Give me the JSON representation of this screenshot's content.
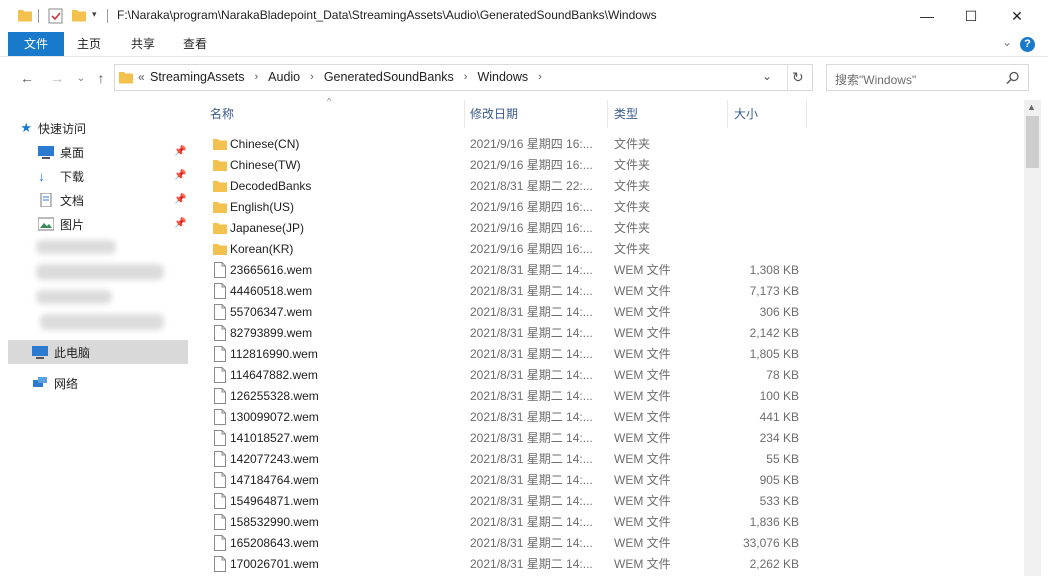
{
  "window": {
    "title": "F:\\Naraka\\program\\NarakaBladepoint_Data\\StreamingAssets\\Audio\\GeneratedSoundBanks\\Windows",
    "minimize_glyph": "—",
    "maximize_glyph": "☐",
    "close_glyph": "✕"
  },
  "ribbon": {
    "tabs": [
      "文件",
      "主页",
      "共享",
      "查看"
    ],
    "expand_glyph": "⌄",
    "help_glyph": "?"
  },
  "address": {
    "overflow": "«",
    "crumbs": [
      "StreamingAssets",
      "Audio",
      "GeneratedSoundBanks",
      "Windows"
    ],
    "dropdown_glyph": "⌄",
    "refresh_glyph": "↻"
  },
  "search": {
    "placeholder": "搜索\"Windows\""
  },
  "nav": {
    "quick_access": "快速访问",
    "pinned": [
      "桌面",
      "下载",
      "文档",
      "图片"
    ],
    "this_pc": "此电脑",
    "network": "网络"
  },
  "columns": {
    "name": "名称",
    "date": "修改日期",
    "type": "类型",
    "size": "大小"
  },
  "files": [
    {
      "name": "Chinese(CN)",
      "date": "2021/9/16 星期四 16:...",
      "type": "文件夹",
      "size": "",
      "kind": "folder"
    },
    {
      "name": "Chinese(TW)",
      "date": "2021/9/16 星期四 16:...",
      "type": "文件夹",
      "size": "",
      "kind": "folder"
    },
    {
      "name": "DecodedBanks",
      "date": "2021/8/31 星期二 22:...",
      "type": "文件夹",
      "size": "",
      "kind": "folder"
    },
    {
      "name": "English(US)",
      "date": "2021/9/16 星期四 16:...",
      "type": "文件夹",
      "size": "",
      "kind": "folder"
    },
    {
      "name": "Japanese(JP)",
      "date": "2021/9/16 星期四 16:...",
      "type": "文件夹",
      "size": "",
      "kind": "folder"
    },
    {
      "name": "Korean(KR)",
      "date": "2021/9/16 星期四 16:...",
      "type": "文件夹",
      "size": "",
      "kind": "folder"
    },
    {
      "name": "23665616.wem",
      "date": "2021/8/31 星期二 14:...",
      "type": "WEM 文件",
      "size": "1,308 KB",
      "kind": "file"
    },
    {
      "name": "44460518.wem",
      "date": "2021/8/31 星期二 14:...",
      "type": "WEM 文件",
      "size": "7,173 KB",
      "kind": "file"
    },
    {
      "name": "55706347.wem",
      "date": "2021/8/31 星期二 14:...",
      "type": "WEM 文件",
      "size": "306 KB",
      "kind": "file"
    },
    {
      "name": "82793899.wem",
      "date": "2021/8/31 星期二 14:...",
      "type": "WEM 文件",
      "size": "2,142 KB",
      "kind": "file"
    },
    {
      "name": "112816990.wem",
      "date": "2021/8/31 星期二 14:...",
      "type": "WEM 文件",
      "size": "1,805 KB",
      "kind": "file"
    },
    {
      "name": "114647882.wem",
      "date": "2021/8/31 星期二 14:...",
      "type": "WEM 文件",
      "size": "78 KB",
      "kind": "file"
    },
    {
      "name": "126255328.wem",
      "date": "2021/8/31 星期二 14:...",
      "type": "WEM 文件",
      "size": "100 KB",
      "kind": "file"
    },
    {
      "name": "130099072.wem",
      "date": "2021/8/31 星期二 14:...",
      "type": "WEM 文件",
      "size": "441 KB",
      "kind": "file"
    },
    {
      "name": "141018527.wem",
      "date": "2021/8/31 星期二 14:...",
      "type": "WEM 文件",
      "size": "234 KB",
      "kind": "file"
    },
    {
      "name": "142077243.wem",
      "date": "2021/8/31 星期二 14:...",
      "type": "WEM 文件",
      "size": "55 KB",
      "kind": "file"
    },
    {
      "name": "147184764.wem",
      "date": "2021/8/31 星期二 14:...",
      "type": "WEM 文件",
      "size": "905 KB",
      "kind": "file"
    },
    {
      "name": "154964871.wem",
      "date": "2021/8/31 星期二 14:...",
      "type": "WEM 文件",
      "size": "533 KB",
      "kind": "file"
    },
    {
      "name": "158532990.wem",
      "date": "2021/8/31 星期二 14:...",
      "type": "WEM 文件",
      "size": "1,836 KB",
      "kind": "file"
    },
    {
      "name": "165208643.wem",
      "date": "2021/8/31 星期二 14:...",
      "type": "WEM 文件",
      "size": "33,076 KB",
      "kind": "file"
    },
    {
      "name": "170026701.wem",
      "date": "2021/8/31 星期二 14:...",
      "type": "WEM 文件",
      "size": "2,262 KB",
      "kind": "file"
    }
  ],
  "colors": {
    "accent": "#1979ca",
    "folder": "#f2c14e",
    "selected_nav": "#d9d9d9"
  }
}
